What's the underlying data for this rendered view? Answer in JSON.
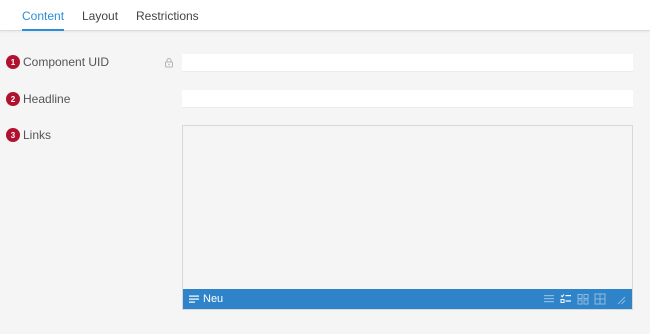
{
  "tabs": [
    {
      "label": "Content",
      "active": true
    },
    {
      "label": "Layout",
      "active": false
    },
    {
      "label": "Restrictions",
      "active": false
    }
  ],
  "fields": {
    "component_uid": {
      "badge": "1",
      "label": "Component UID",
      "value": "",
      "locked": true
    },
    "headline": {
      "badge": "2",
      "label": "Headline",
      "value": ""
    },
    "links": {
      "badge": "3",
      "label": "Links"
    }
  },
  "links_toolbar": {
    "new_label": "Neu",
    "icons": [
      "list-icon",
      "checklist-icon",
      "grid-icon",
      "grid-alt-icon",
      "resize-handle-icon"
    ]
  },
  "colors": {
    "accent": "#2a8fd8",
    "toolbar": "#2f84c9",
    "badge": "#b1112e",
    "background": "#f5f5f5"
  }
}
